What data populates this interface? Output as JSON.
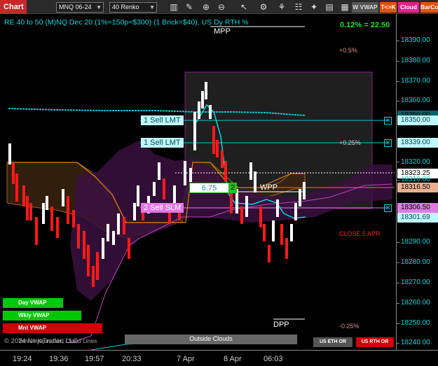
{
  "toolbar": {
    "app_title": "Chart",
    "instrument": "MNQ 06-24",
    "bar_type": "40 Renko",
    "w_vwap": "W VWAP",
    "tk": "T<>K",
    "cloud": "Cloud",
    "barco": "BarCo"
  },
  "chart": {
    "title": "RE 40 to 50 (M)NQ Dec 20 (1%=150p=$300) (1 Brick=$40), US Dy RTH %",
    "change_readout": "0.12% = 22.50",
    "mpp": "MPP",
    "wpp": "WPP",
    "dpp": "DPP",
    "pct_plus_05": "+0.5%",
    "pct_plus_025": "+0.25%",
    "pct_minus_025": "-0.25%",
    "close_label": "CLOSE 5 APR",
    "copyright": "© 2024 NinjaTrader, LLC",
    "outside_clouds": "Outside Clouds",
    "kumo_label": "Teniun Kijun Fast Cloud Lines",
    "position_qty": "6.75",
    "position_count": "2",
    "colors": {
      "accent": "#00d8e0",
      "up": "#ffffff",
      "down": "#ff1a1a",
      "sell": "#e676e6",
      "vwap_green": "#00c800",
      "vwap_red": "#d00000"
    }
  },
  "orders": [
    {
      "label": "1 Sell LMT",
      "price": "18350.00"
    },
    {
      "label": "1 Sell LMT",
      "price": "18339.00"
    },
    {
      "label": "2 Sell SLM",
      "price": "18306.50"
    }
  ],
  "vwap_buttons": {
    "day": "Day VWAP",
    "weekly": "Wkly VWAP",
    "monthly": "Mnt VWAP"
  },
  "or_buttons": {
    "eth": "US ETH OR",
    "rth": "US RTH OR"
  },
  "price_axis": {
    "ticks": [
      "18390.00",
      "18380.00",
      "18370.00",
      "18360.00",
      "18320.00",
      "18310.00",
      "18290.00",
      "18280.00",
      "18270.00",
      "18260.00",
      "18250.00",
      "18240.00"
    ],
    "tags": {
      "last": "18323.25",
      "current": "18316.50",
      "low": "18301.69",
      "vwap": "18350.00"
    }
  },
  "time_axis": [
    "19:24",
    "19:36",
    "19:57",
    "20:33",
    "7 Apr",
    "8 Apr",
    "06:03"
  ]
}
